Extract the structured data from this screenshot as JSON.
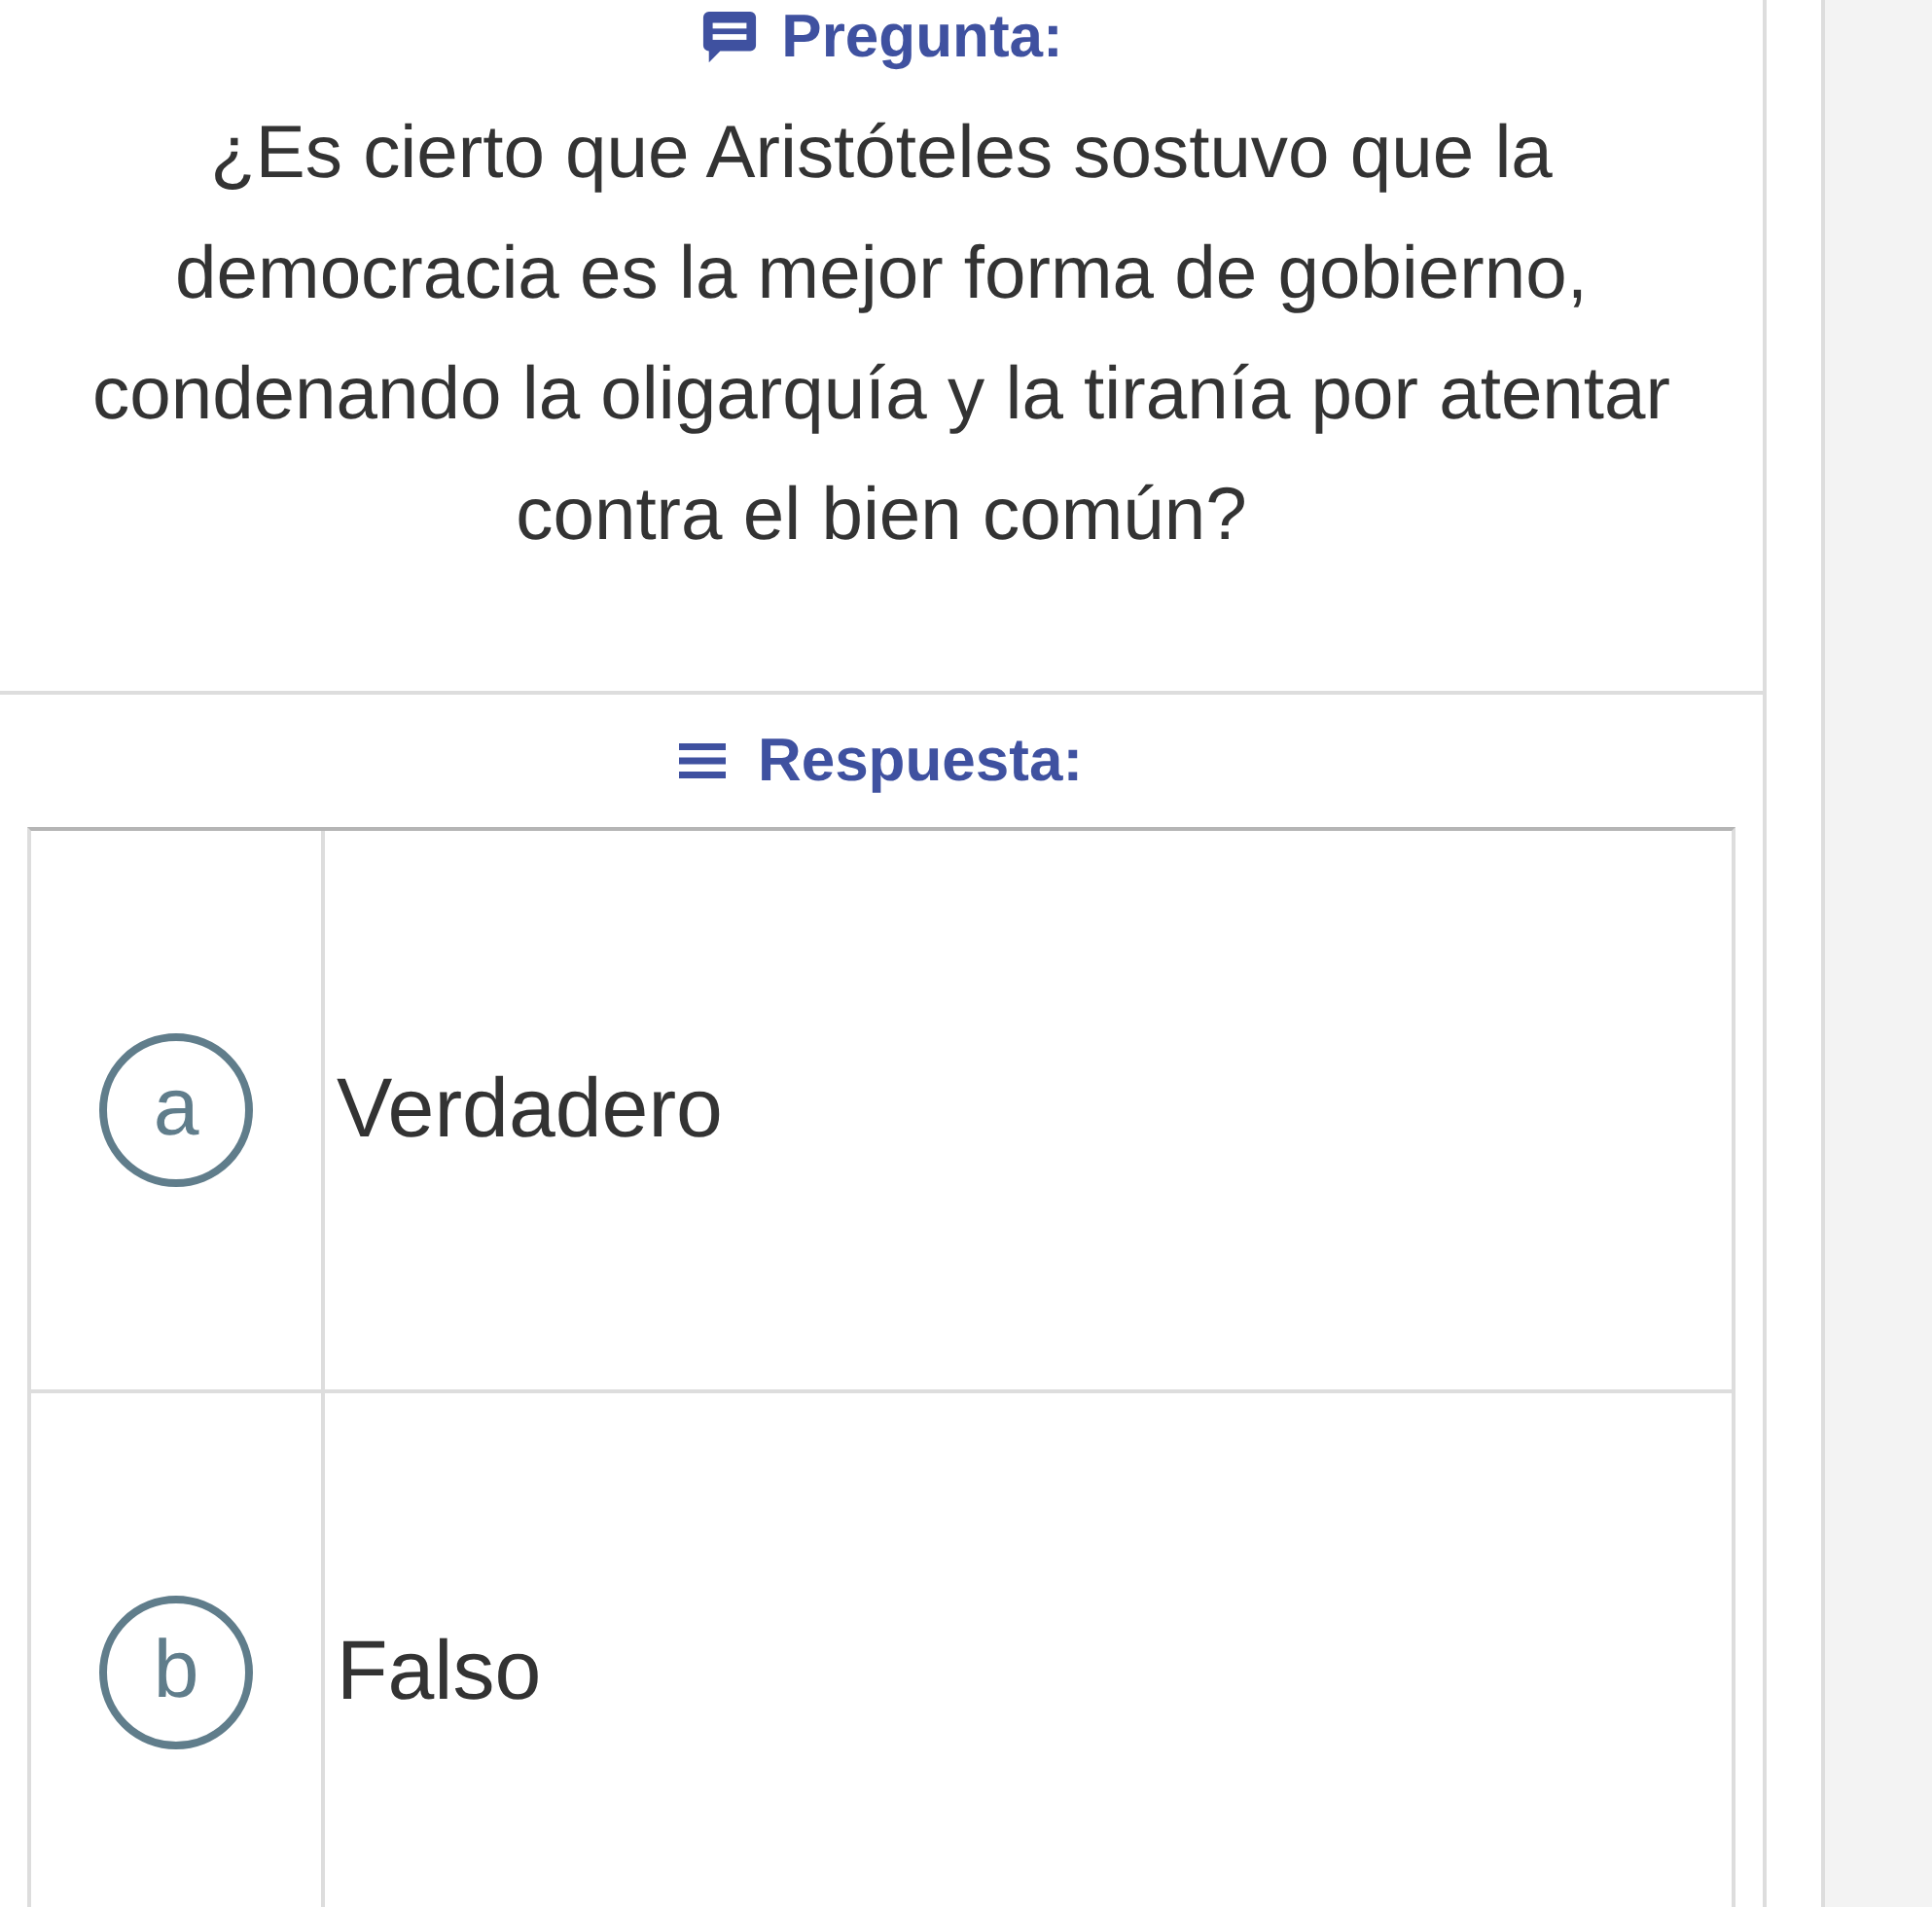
{
  "question": {
    "heading": "Pregunta:",
    "text": "¿Es cierto que Aristóteles sostuvo que la democracia es la mejor forma de gobierno, condenando la oligarquía y la tiranía por atentar contra el bien común?"
  },
  "answer": {
    "heading": "Respuesta:",
    "options": [
      {
        "letter": "a",
        "text": "Verdadero",
        "selected": false
      },
      {
        "letter": "b",
        "text": "Falso",
        "selected": false
      }
    ]
  }
}
